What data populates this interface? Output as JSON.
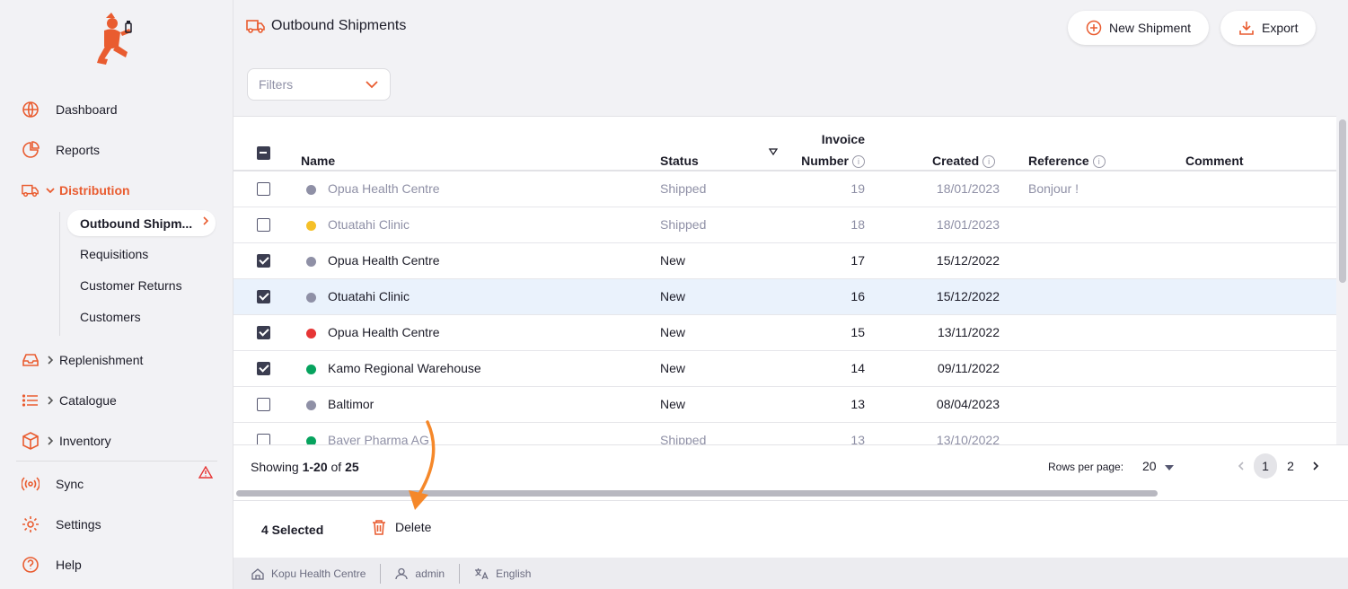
{
  "sidebar": {
    "items": [
      {
        "label": "Dashboard",
        "icon": "globe-icon"
      },
      {
        "label": "Reports",
        "icon": "pie-chart-icon"
      },
      {
        "label": "Distribution",
        "icon": "truck-icon"
      },
      {
        "label": "Replenishment",
        "icon": "inbox-icon"
      },
      {
        "label": "Catalogue",
        "icon": "list-icon"
      },
      {
        "label": "Inventory",
        "icon": "box-icon"
      },
      {
        "label": "Sync",
        "icon": "broadcast-icon"
      },
      {
        "label": "Settings",
        "icon": "gear-icon"
      },
      {
        "label": "Help",
        "icon": "help-circle-icon"
      }
    ],
    "distribution_sub": [
      {
        "label": "Outbound Shipm..."
      },
      {
        "label": "Requisitions"
      },
      {
        "label": "Customer Returns"
      },
      {
        "label": "Customers"
      }
    ]
  },
  "header": {
    "title": "Outbound Shipments",
    "new_shipment_label": "New Shipment",
    "export_label": "Export"
  },
  "filters": {
    "placeholder": "Filters"
  },
  "table": {
    "columns": {
      "name": "Name",
      "status": "Status",
      "invoice_line1": "Invoice",
      "invoice_line2": "Number",
      "created": "Created",
      "reference": "Reference",
      "comment": "Comment"
    },
    "rows": [
      {
        "name": "Opua Health Centre",
        "status": "Shipped",
        "invoice": "19",
        "created": "18/01/2023",
        "reference": "Bonjour !",
        "dot": "#8f90a6",
        "checked": false,
        "muted": true
      },
      {
        "name": "Otuatahi Clinic",
        "status": "Shipped",
        "invoice": "18",
        "created": "18/01/2023",
        "reference": "",
        "dot": "#f5c028",
        "checked": false,
        "muted": true
      },
      {
        "name": "Opua Health Centre",
        "status": "New",
        "invoice": "17",
        "created": "15/12/2022",
        "reference": "",
        "dot": "#8f90a6",
        "checked": true,
        "muted": false
      },
      {
        "name": "Otuatahi Clinic",
        "status": "New",
        "invoice": "16",
        "created": "15/12/2022",
        "reference": "",
        "dot": "#8f90a6",
        "checked": true,
        "muted": false
      },
      {
        "name": "Opua Health Centre",
        "status": "New",
        "invoice": "15",
        "created": "13/11/2022",
        "reference": "",
        "dot": "#e63535",
        "checked": true,
        "muted": false
      },
      {
        "name": "Kamo Regional Warehouse",
        "status": "New",
        "invoice": "14",
        "created": "09/11/2022",
        "reference": "",
        "dot": "#06a35e",
        "checked": true,
        "muted": false
      },
      {
        "name": "Baltimor",
        "status": "New",
        "invoice": "13",
        "created": "08/04/2023",
        "reference": "",
        "dot": "#8f90a6",
        "checked": false,
        "muted": false
      },
      {
        "name": "Bayer Pharma AG",
        "status": "Shipped",
        "invoice": "13",
        "created": "13/10/2022",
        "reference": "",
        "dot": "#06a35e",
        "checked": false,
        "muted": true
      }
    ]
  },
  "pagination": {
    "showing_prefix": "Showing ",
    "range": "1-20",
    "of": " of ",
    "total": "25",
    "rows_per_page_label": "Rows per page:",
    "rows_per_page": "20",
    "pages": [
      "1",
      "2"
    ]
  },
  "action_bar": {
    "selected": "4 Selected",
    "delete_label": "Delete"
  },
  "status_bar": {
    "store": "Kopu Health Centre",
    "user": "admin",
    "language": "English"
  },
  "colors": {
    "accent": "#e95c30",
    "annotation": "#f5882a"
  }
}
